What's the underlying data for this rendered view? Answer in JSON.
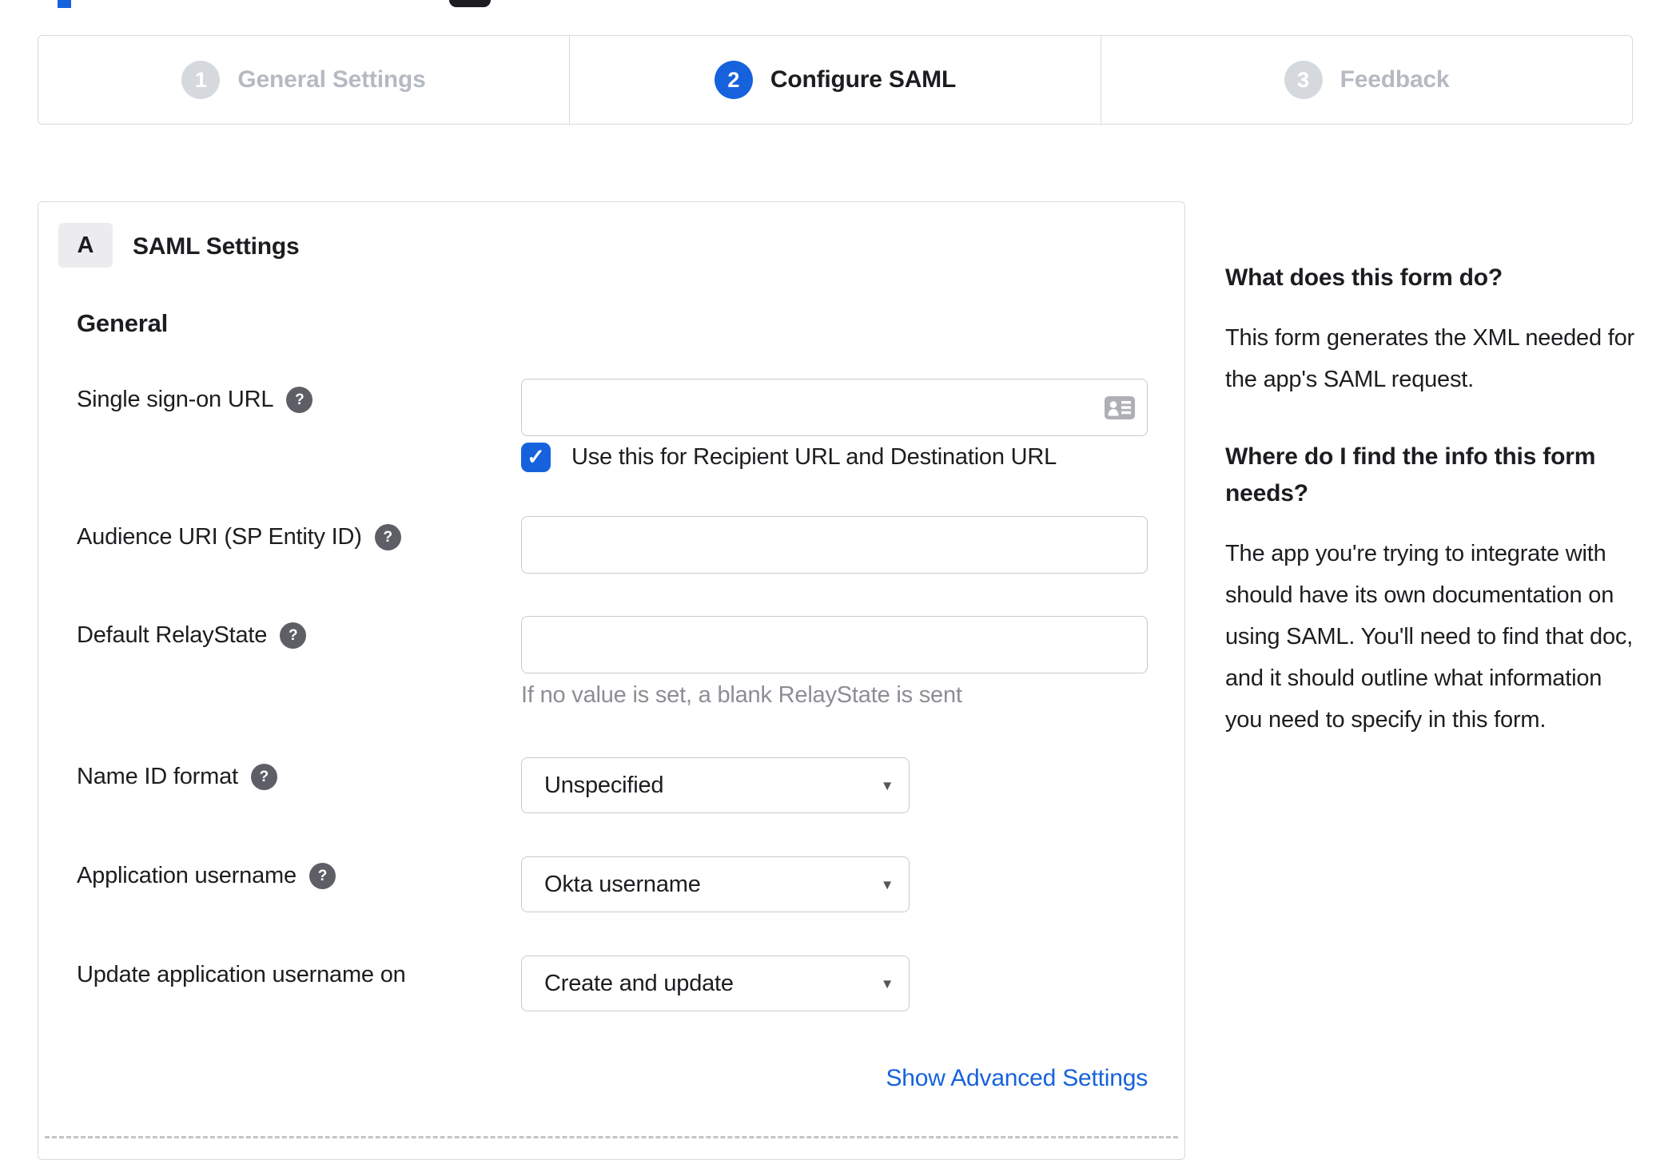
{
  "glyphs": {
    "help": "?",
    "caret": "▾",
    "check": "✓"
  },
  "colors": {
    "accent_blue": "#1662dd",
    "border_gray": "#d9dade",
    "inactive_step_gray": "#d5d9de",
    "text_dark": "#1d1d21",
    "muted_text": "#8d8d95"
  },
  "stepper": {
    "steps": [
      {
        "number": "1",
        "label": "General Settings",
        "state": "inactive"
      },
      {
        "number": "2",
        "label": "Configure SAML",
        "state": "active"
      },
      {
        "number": "3",
        "label": "Feedback",
        "state": "inactive"
      }
    ]
  },
  "panel": {
    "badge": "A",
    "title": "SAML Settings",
    "group": "General",
    "fields": {
      "sso_url": {
        "label": "Single sign-on URL",
        "value": ""
      },
      "sso_checkbox": {
        "label": "Use this for Recipient URL and Destination URL",
        "checked": true
      },
      "audience_uri": {
        "label": "Audience URI (SP Entity ID)",
        "value": ""
      },
      "relay_state": {
        "label": "Default RelayState",
        "value": "",
        "hint": "If no value is set, a blank RelayState is sent"
      },
      "name_id_format": {
        "label": "Name ID format",
        "value": "Unspecified"
      },
      "app_username": {
        "label": "Application username",
        "value": "Okta username"
      },
      "update_app_username": {
        "label": "Update application username on",
        "value": "Create and update"
      }
    },
    "advanced_link": "Show Advanced Settings"
  },
  "sidebar": {
    "sections": [
      {
        "heading": "What does this form do?",
        "body": "This form generates the XML needed for the app's SAML request."
      },
      {
        "heading": "Where do I find the info this form needs?",
        "body": "The app you're trying to integrate with should have its own documentation on using SAML. You'll need to find that doc, and it should outline what information you need to specify in this form."
      }
    ]
  }
}
